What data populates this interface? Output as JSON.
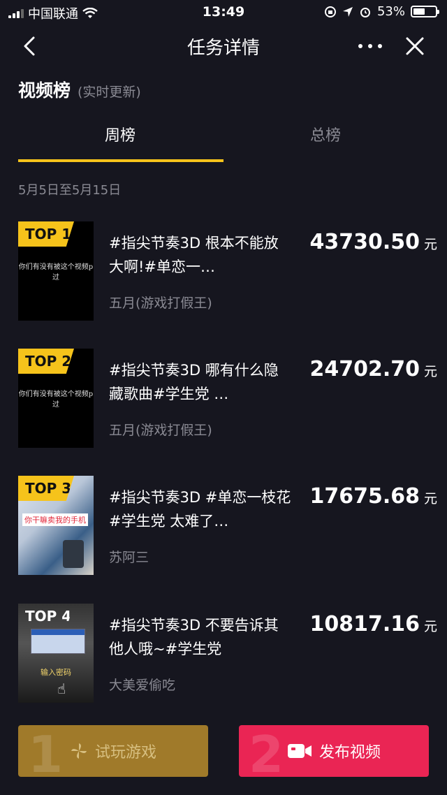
{
  "status_bar": {
    "carrier": "中国联通",
    "time": "13:49",
    "battery": "53%",
    "battery_level": 0.53
  },
  "nav": {
    "title": "任务详情"
  },
  "section": {
    "title": "视频榜",
    "subtitle": "(实时更新)"
  },
  "tabs": [
    {
      "label": "周榜"
    },
    {
      "label": "总榜"
    }
  ],
  "date_range": "5月5日至5月15日",
  "items": [
    {
      "rank": "TOP 1",
      "title": "#指尖节奏3D 根本不能放大啊!#单恋一…",
      "thumb_caption": "你们有没有被这个视频p过",
      "author": "五月(游戏打假王)",
      "amount": "43730.50",
      "unit": "元"
    },
    {
      "rank": "TOP 2",
      "title": "#指尖节奏3D 哪有什么隐藏歌曲#学生党 …",
      "thumb_caption": "你们有没有被这个视频p过",
      "author": "五月(游戏打假王)",
      "amount": "24702.70",
      "unit": "元"
    },
    {
      "rank": "TOP 3",
      "title": "#指尖节奏3D #单恋一枝花 #学生党 太难了…",
      "thumb_caption": "你干嘛卖我的手机",
      "author": "苏阿三",
      "amount": "17675.68",
      "unit": "元"
    },
    {
      "rank": "TOP 4",
      "title": "#指尖节奏3D 不要告诉其他人哦~#学生党",
      "thumb_caption": "输入密码",
      "author": "大美爱偷吃",
      "amount": "10817.16",
      "unit": "元"
    }
  ],
  "buttons": {
    "play": {
      "number": "1",
      "label": "试玩游戏"
    },
    "publish": {
      "number": "2",
      "label": "发布视频"
    }
  },
  "colors": {
    "accent": "#f6c31b",
    "publish": "#ea2554",
    "background": "#16161f"
  }
}
